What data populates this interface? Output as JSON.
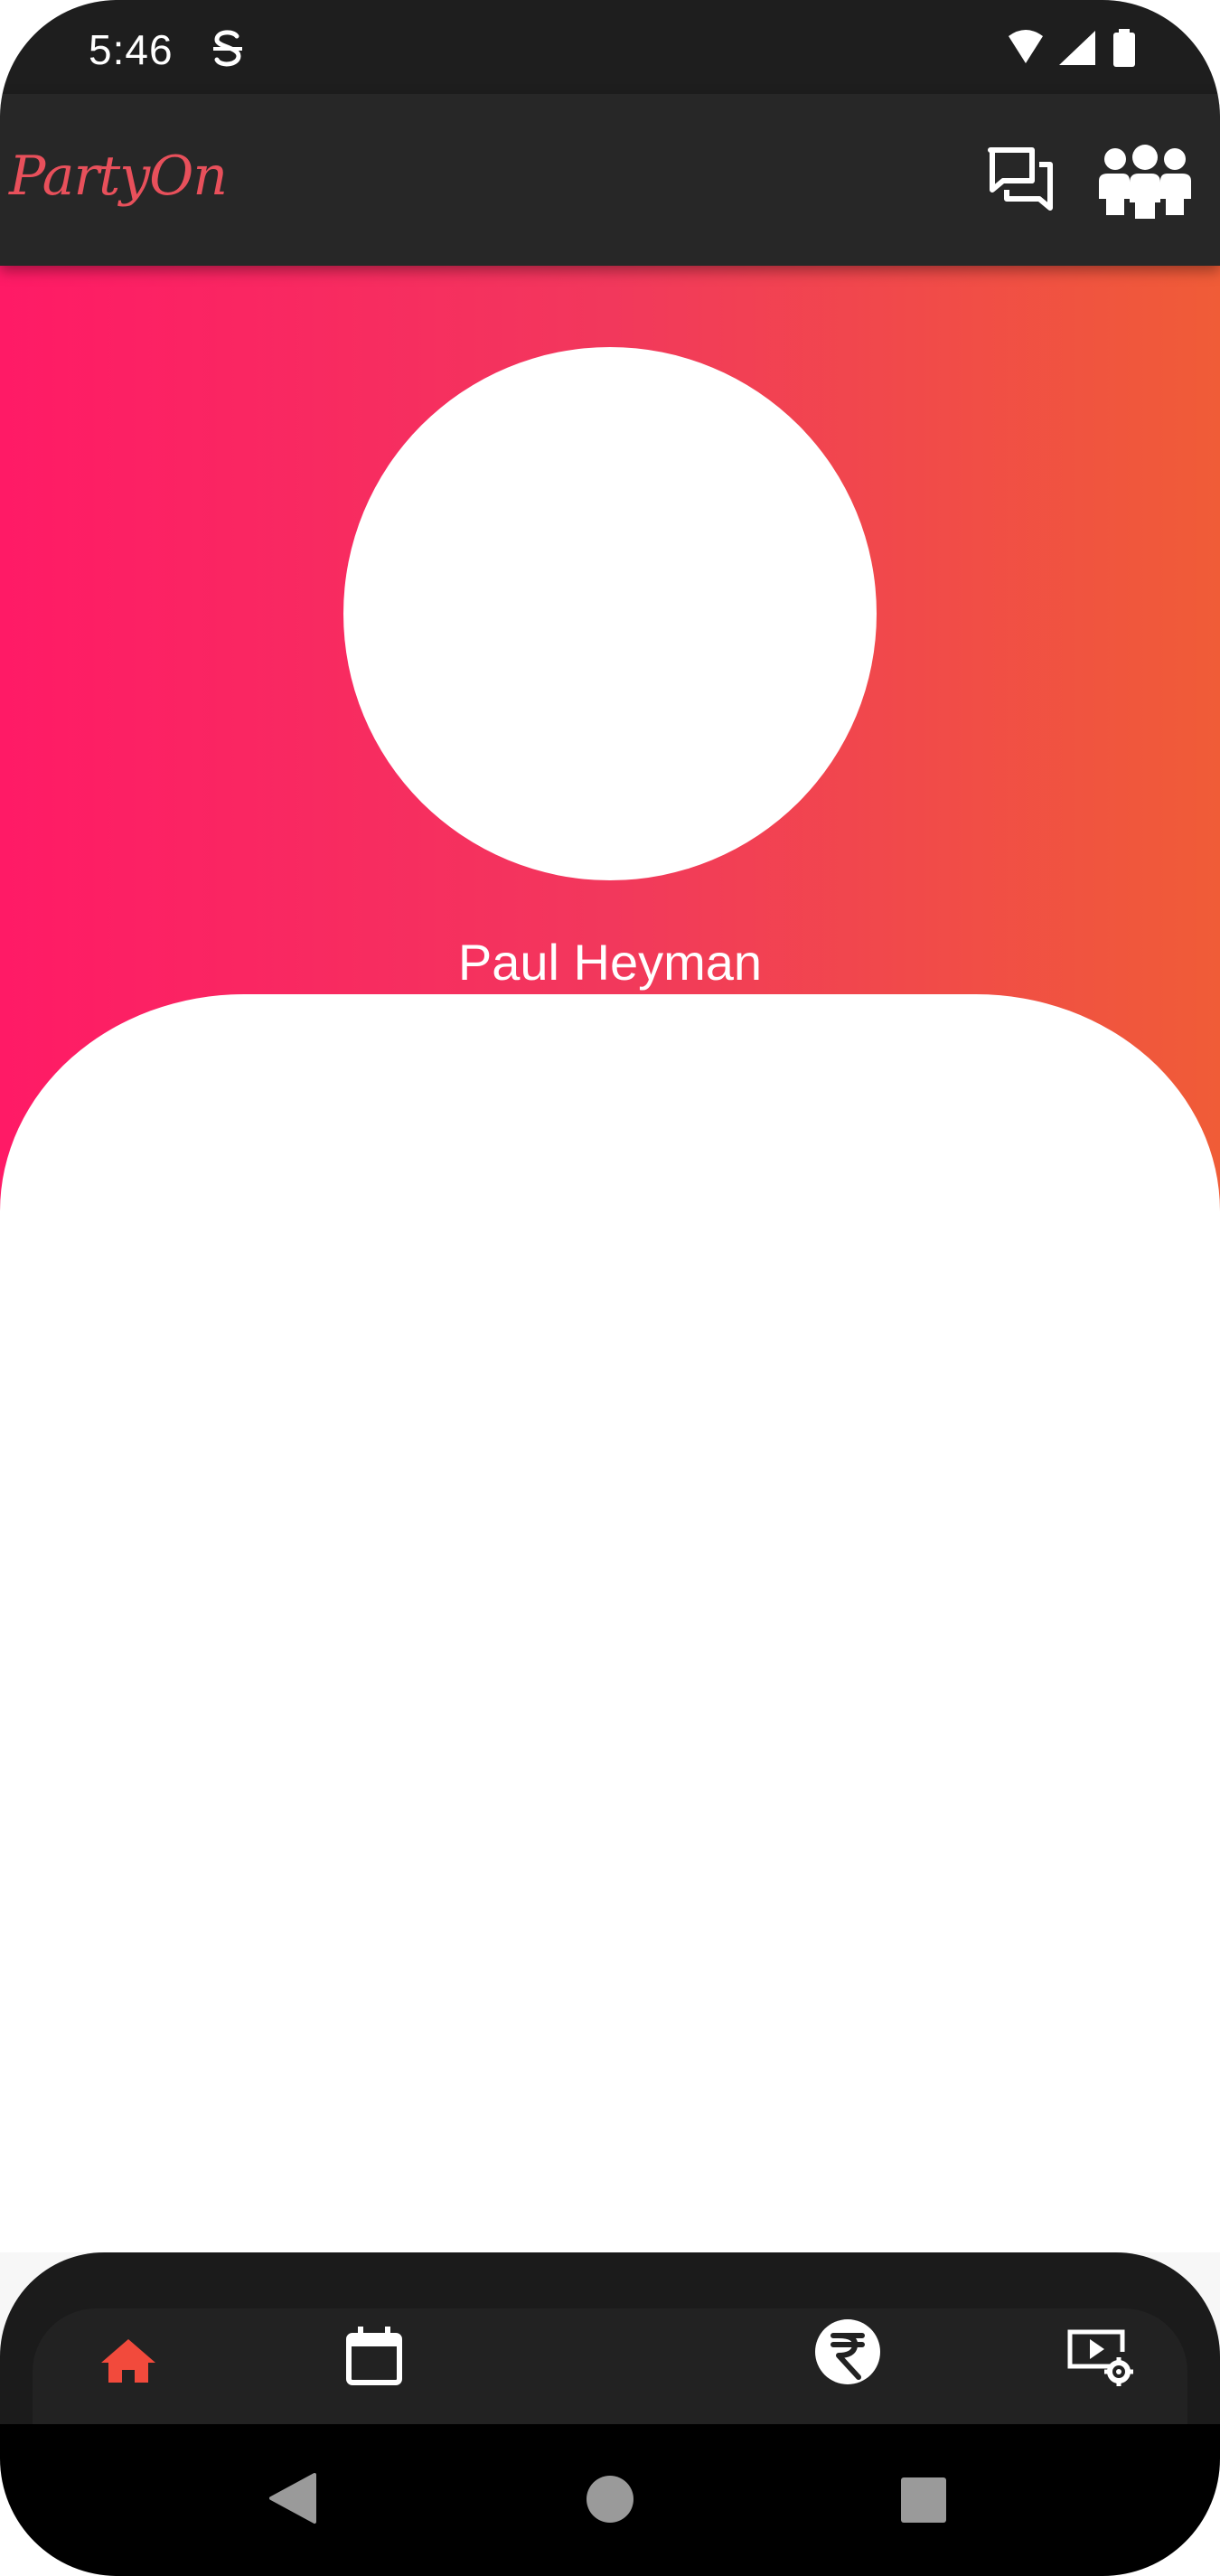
{
  "status_bar": {
    "time": "5:46",
    "icons": [
      "s-app-icon",
      "wifi-icon",
      "signal-icon",
      "battery-icon"
    ]
  },
  "app_bar": {
    "logo_text": "PartyOn",
    "actions": [
      "chat-icon",
      "group-icon"
    ]
  },
  "profile": {
    "name": "Paul Heyman"
  },
  "bottom_nav": {
    "items": [
      {
        "icon": "home-icon",
        "active": true
      },
      {
        "icon": "calendar-icon",
        "active": false
      },
      {
        "icon": "rupee-icon",
        "active": false
      },
      {
        "icon": "video-settings-icon",
        "active": false
      }
    ]
  },
  "system_nav": {
    "buttons": [
      "back-icon",
      "home-circle-icon",
      "recents-icon"
    ]
  },
  "colors": {
    "gradient_start": "#ff1a66",
    "gradient_end": "#f05c37",
    "accent": "#e8505b",
    "app_bar": "#272727",
    "active_nav": "#f24a3c"
  }
}
